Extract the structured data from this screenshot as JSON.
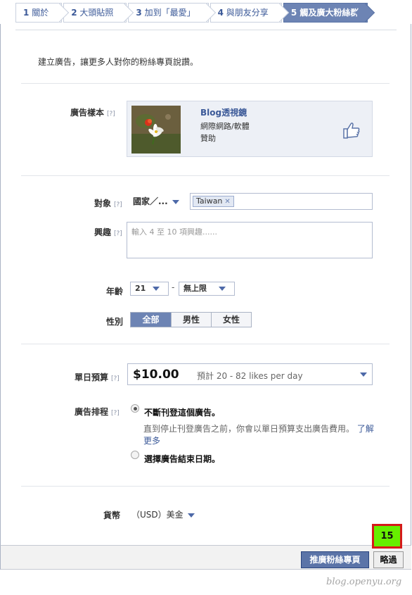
{
  "steps": [
    {
      "num": "1",
      "label": "關於"
    },
    {
      "num": "2",
      "label": "大頭貼照"
    },
    {
      "num": "3",
      "label": "加到「最愛」"
    },
    {
      "num": "4",
      "label": "與朋友分享"
    },
    {
      "num": "5",
      "label": "觸及廣大粉絲群"
    }
  ],
  "intro": "建立廣告，讓更多人對你的粉絲專頁說讚。",
  "help_marker": "[?]",
  "ad_sample": {
    "label": "廣告樣本",
    "title": "Blog透視鏡",
    "category": "網際網路/軟體",
    "sponsored": "贊助",
    "like_icon": "thumbs-up-icon"
  },
  "targeting": {
    "audience_label": "對象",
    "country_select": "國家／...",
    "countries": [
      "Taiwan"
    ],
    "interests_label": "興趣",
    "interests_placeholder": "輸入 4 至 10 項興趣......",
    "age_label": "年齡",
    "age_min": "21",
    "age_dash": "-",
    "age_max": "無上限",
    "gender_label": "性別",
    "genders": [
      "全部",
      "男性",
      "女性"
    ],
    "gender_selected": "全部"
  },
  "budget": {
    "label": "單日預算",
    "amount": "$10.00",
    "estimate": "預計 20 - 82 likes per day"
  },
  "schedule": {
    "label": "廣告排程",
    "option_continuous": "不斷刊登這個廣告。",
    "help_text": "直到停止刊登廣告之前，你會以單日預算支出廣告費用。",
    "learn_more": "了解更多",
    "option_end_date": "選擇廣告結束日期。",
    "selected": "continuous"
  },
  "currency": {
    "label": "貨幣",
    "value": "（USD）美金"
  },
  "footer": {
    "promote_button": "推廣粉絲專頁",
    "skip_button": "略過",
    "badge": "15"
  },
  "watermark": "blog.openyu.org",
  "colors": {
    "brand": "#3b5998",
    "active_step": "#6d84b4",
    "badge_bg": "#66ee00",
    "badge_border": "#d51a1a"
  }
}
